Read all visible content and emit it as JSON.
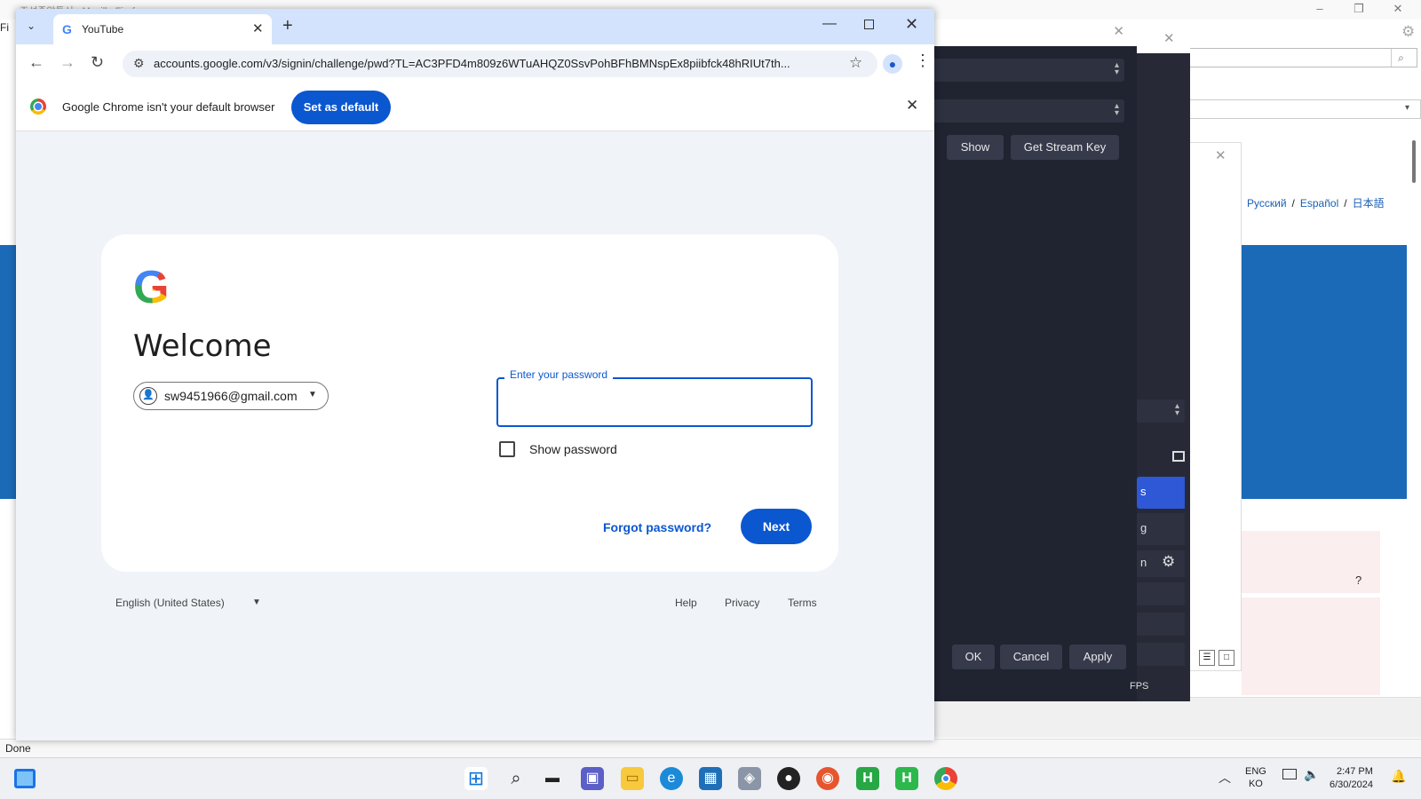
{
  "firefox": {
    "title": "조선중앙통신 - Mozilla Firefox",
    "menu_first_letter": "Fi",
    "status_text": "Done",
    "languages": [
      "Русский",
      "Español",
      "日本語"
    ],
    "help_mark": "?"
  },
  "obs": {
    "show_button": "Show",
    "get_stream_key_button": "Get Stream Key",
    "ok_button": "OK",
    "cancel_button": "Cancel",
    "apply_button": "Apply",
    "fps_label": "FPS",
    "blue_item_fragment": "s",
    "item_fragment": "g",
    "row_fragment": "n"
  },
  "chrome": {
    "tab_title": "YouTube",
    "url": "accounts.google.com/v3/signin/challenge/pwd?TL=AC3PFD4m809z6WTuAHQZ0SsvPohBFhBMNspEx8piibfck48hRIUt7th...",
    "infobar": {
      "text": "Google Chrome isn't your default browser",
      "button": "Set as default"
    }
  },
  "signin": {
    "logo": "G",
    "heading": "Welcome",
    "account_email": "sw9451966@gmail.com",
    "password_label": "Enter your password",
    "password_value": "",
    "show_password_label": "Show password",
    "show_password_checked": false,
    "forgot_password": "Forgot password?",
    "next_button": "Next",
    "footer": {
      "language": "English (United States)",
      "links": [
        "Help",
        "Privacy",
        "Terms"
      ]
    }
  },
  "taskbar": {
    "apps": [
      "start-icon",
      "search-icon",
      "file-explorer-window-icon",
      "teams-icon",
      "folder-icon",
      "edge-icon",
      "store-icon",
      "app-icon",
      "obs-icon",
      "firefox-icon",
      "hwp-icon",
      "hwp-icon-2",
      "chrome-icon"
    ],
    "lang_top": "ENG",
    "lang_bottom": "KO",
    "time": "2:47 PM",
    "date": "6/30/2024"
  }
}
